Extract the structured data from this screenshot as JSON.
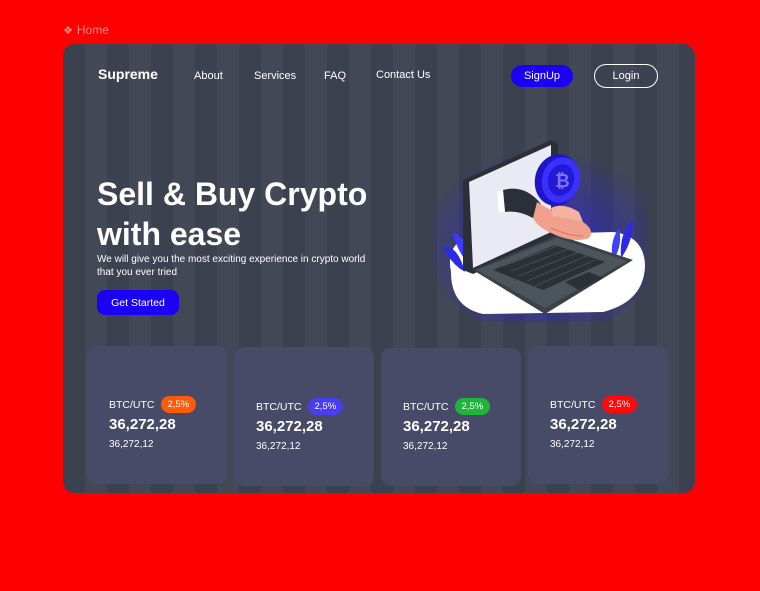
{
  "breadcrumb": {
    "icon": "diamond-icon",
    "label": "Home"
  },
  "header": {
    "logo": "Supreme",
    "nav": [
      "About",
      "Services",
      "FAQ",
      "Contact Us"
    ],
    "signup_label": "SignUp",
    "login_label": "Login"
  },
  "hero": {
    "title_line1": "Sell & Buy Crypto",
    "title_line2": "with ease",
    "subtitle": "We will give you the most exciting experience in crypto world that you ever tried",
    "cta_label": "Get Started",
    "illustration": "laptop-crypto-hand-icon"
  },
  "colors": {
    "page_bg": "#ff0000",
    "frame_bg": "#3c4150",
    "card_bg": "#474b67",
    "accent": "#1b00f5"
  },
  "tickers": [
    {
      "pair": "BTC/UTC",
      "change": "2,5%",
      "badge_color": "#ff5a0a",
      "price": "36,272,28",
      "sub": "36,272,12"
    },
    {
      "pair": "BTC/UTC",
      "change": "2,5%",
      "badge_color": "#4a3df0",
      "price": "36,272,28",
      "sub": "36,272,12"
    },
    {
      "pair": "BTC/UTC",
      "change": "2,5%",
      "badge_color": "#1fb53c",
      "price": "36,272,28",
      "sub": "36,272,12"
    },
    {
      "pair": "BTC/UTC",
      "change": "2,5%",
      "badge_color": "#ff0a0a",
      "price": "36,272,28",
      "sub": "36,272,12"
    }
  ]
}
